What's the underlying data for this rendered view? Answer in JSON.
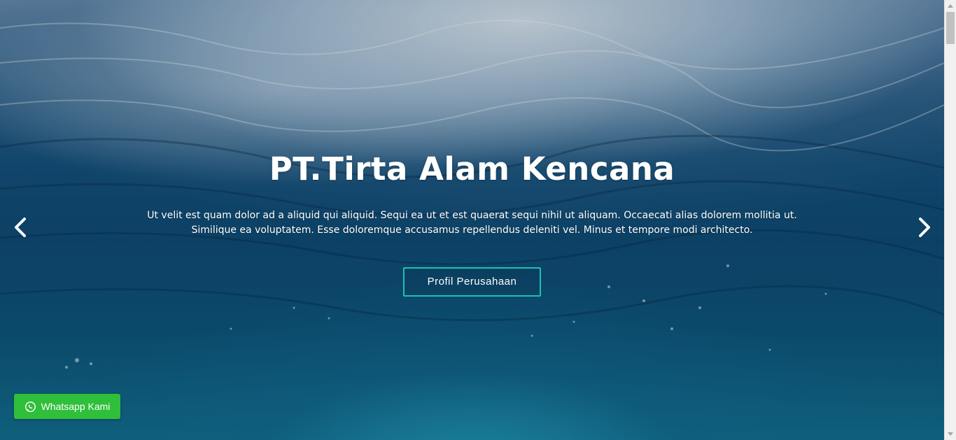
{
  "hero": {
    "title": "PT.Tirta Alam Kencana",
    "description": "Ut velit est quam dolor ad a aliquid qui aliquid. Sequi ea ut et est quaerat sequi nihil ut aliquam. Occaecati alias dolorem mollitia ut. Similique ea voluptatem. Esse doloremque accusamus repellendus deleniti vel. Minus et tempore modi architecto.",
    "cta_label": "Profil Perusahaan",
    "prev_icon": "chevron-left-icon",
    "next_icon": "chevron-right-icon"
  },
  "whatsapp": {
    "label": "Whatsapp Kami",
    "icon": "whatsapp-icon",
    "color": "#2fbf3a"
  },
  "colors": {
    "accent": "#1ec0b6",
    "text": "#ffffff"
  }
}
